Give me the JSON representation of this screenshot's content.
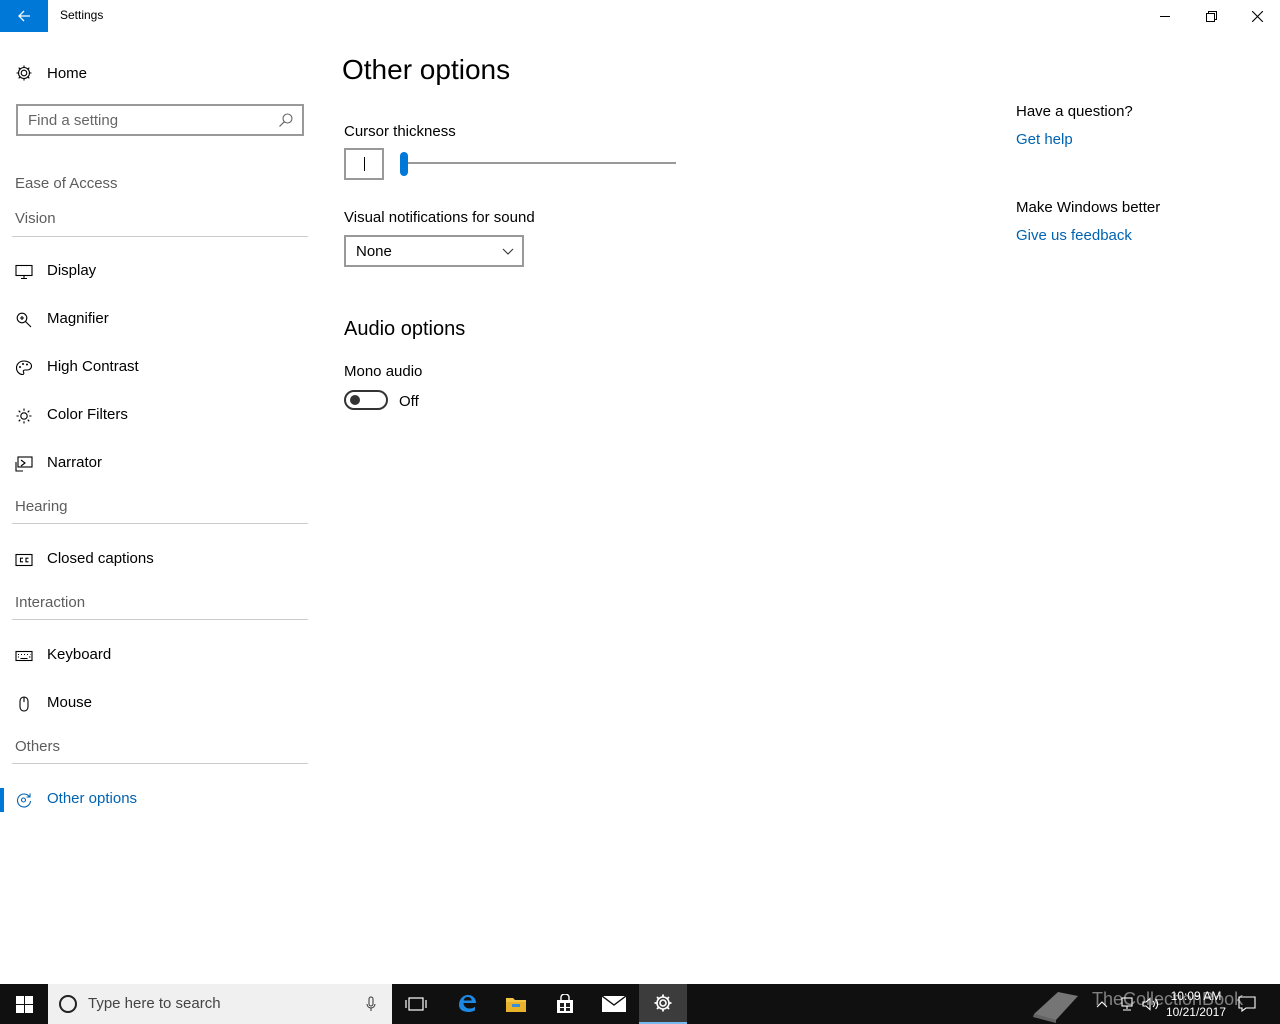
{
  "window": {
    "title": "Settings"
  },
  "sidebar": {
    "home_label": "Home",
    "search_placeholder": "Find a setting",
    "category": "Ease of Access",
    "sections": {
      "vision": "Vision",
      "hearing": "Hearing",
      "interaction": "Interaction",
      "others": "Others"
    },
    "items": [
      {
        "label": "Display",
        "icon": "monitor-icon"
      },
      {
        "label": "Magnifier",
        "icon": "magnifier-icon"
      },
      {
        "label": "High Contrast",
        "icon": "palette-icon"
      },
      {
        "label": "Color Filters",
        "icon": "sun-icon"
      },
      {
        "label": "Narrator",
        "icon": "narrator-icon"
      },
      {
        "label": "Closed captions",
        "icon": "cc-icon"
      },
      {
        "label": "Keyboard",
        "icon": "keyboard-icon"
      },
      {
        "label": "Mouse",
        "icon": "mouse-icon"
      },
      {
        "label": "Other options",
        "icon": "other-options-icon",
        "active": true
      }
    ]
  },
  "main": {
    "title": "Other options",
    "cursor_thickness_label": "Cursor thickness",
    "cursor_thickness_value": 1,
    "visual_notifications_label": "Visual notifications for sound",
    "visual_notifications_value": "None",
    "audio_title": "Audio options",
    "mono_audio_label": "Mono audio",
    "mono_audio_state": "Off"
  },
  "aside": {
    "question": "Have a question?",
    "help_link": "Get help",
    "better": "Make Windows better",
    "feedback_link": "Give us feedback"
  },
  "taskbar": {
    "search_placeholder": "Type here to search",
    "time": "10:09 AM",
    "date": "10/21/2017",
    "watermark": "TheCollectionBook"
  },
  "colors": {
    "accent": "#0078d7",
    "link": "#0063b1",
    "taskbar": "#101010"
  }
}
